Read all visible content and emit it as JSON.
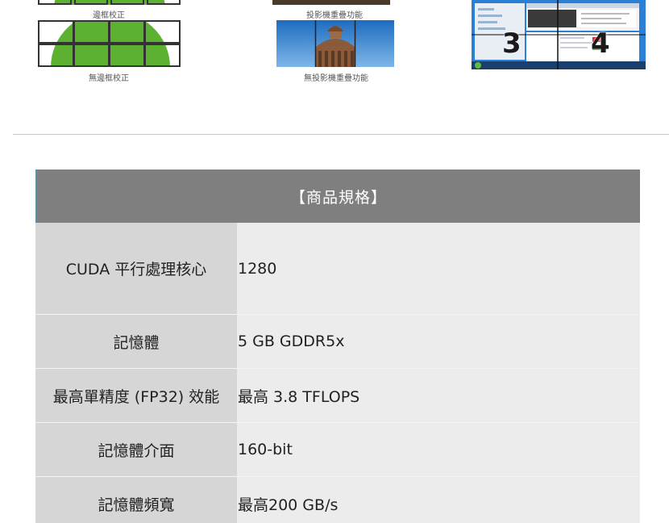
{
  "features": {
    "bezel_on_caption": "邊框校正",
    "bezel_off_caption": "無邊框校正",
    "projector_on_caption": "投影機重疊功能",
    "projector_off_caption": "無投影機重疊功能",
    "multi_screen_numbers": [
      "3",
      "4"
    ]
  },
  "spec": {
    "header": "【商品規格】",
    "rows": [
      {
        "label": "CUDA 平行處理核心",
        "value": "1280"
      },
      {
        "label": "記憶體",
        "value": "5 GB GDDR5x"
      },
      {
        "label": "最高單精度 (FP32) 效能",
        "value": "最高 3.8 TFLOPS"
      },
      {
        "label": "記憶體介面",
        "value": "160-bit"
      },
      {
        "label": "記憶體頻寬",
        "value": "最高200 GB/s"
      }
    ]
  },
  "colors": {
    "header_bg": "#7f7f7f",
    "label_bg": "#d6d6d6",
    "value_bg": "#ececec",
    "bezel_green": "#5cb130",
    "desktop_blue": "#1f6fc0"
  }
}
